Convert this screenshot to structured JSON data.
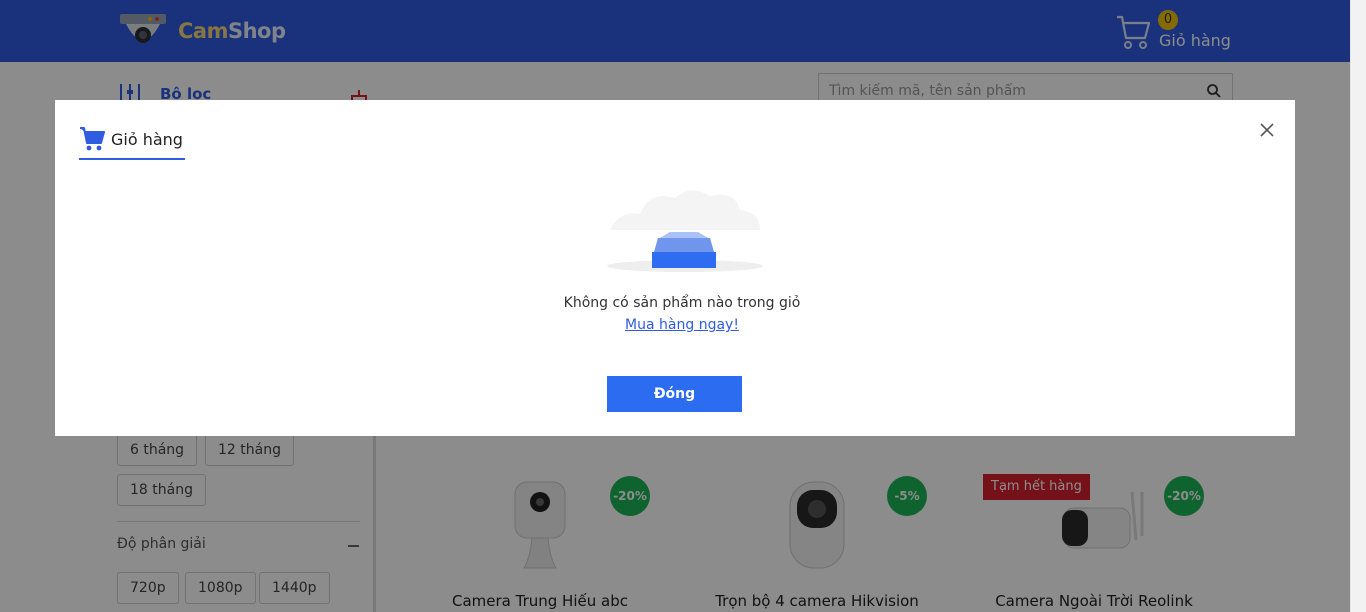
{
  "header": {
    "logo_cam": "Cam",
    "logo_shop": "Shop",
    "cart_count": "0",
    "cart_label": "Giỏ hàng",
    "cart_icon": "cart-icon",
    "bg_color": "#2f5ce0"
  },
  "sidebar": {
    "filter_title": "Bộ lọc",
    "warranty_chips": [
      "6 tháng",
      "12 tháng",
      "18 tháng"
    ],
    "resolution_title": "Độ phân giải",
    "resolution_chips": [
      "720p",
      "1080p",
      "1440p"
    ]
  },
  "search": {
    "placeholder": "Tìm kiếm mã, tên sản phẩm",
    "value": ""
  },
  "products": [
    {
      "name": "Camera Trung Hiếu abc",
      "discount": "-20%",
      "badge": ""
    },
    {
      "name": "Trọn bộ 4 camera Hikvision",
      "discount": "-5%",
      "badge": ""
    },
    {
      "name": "Camera Ngoài Trời Reolink",
      "discount": "-20%",
      "badge": "Tạm hết hàng"
    }
  ],
  "modal": {
    "title": "Giỏ hàng",
    "empty_text": "Không có sản phẩm nào trong giỏ",
    "shop_link": "Mua hàng ngay!",
    "close_button": "Đóng",
    "accent_color": "#2b6cf0"
  }
}
